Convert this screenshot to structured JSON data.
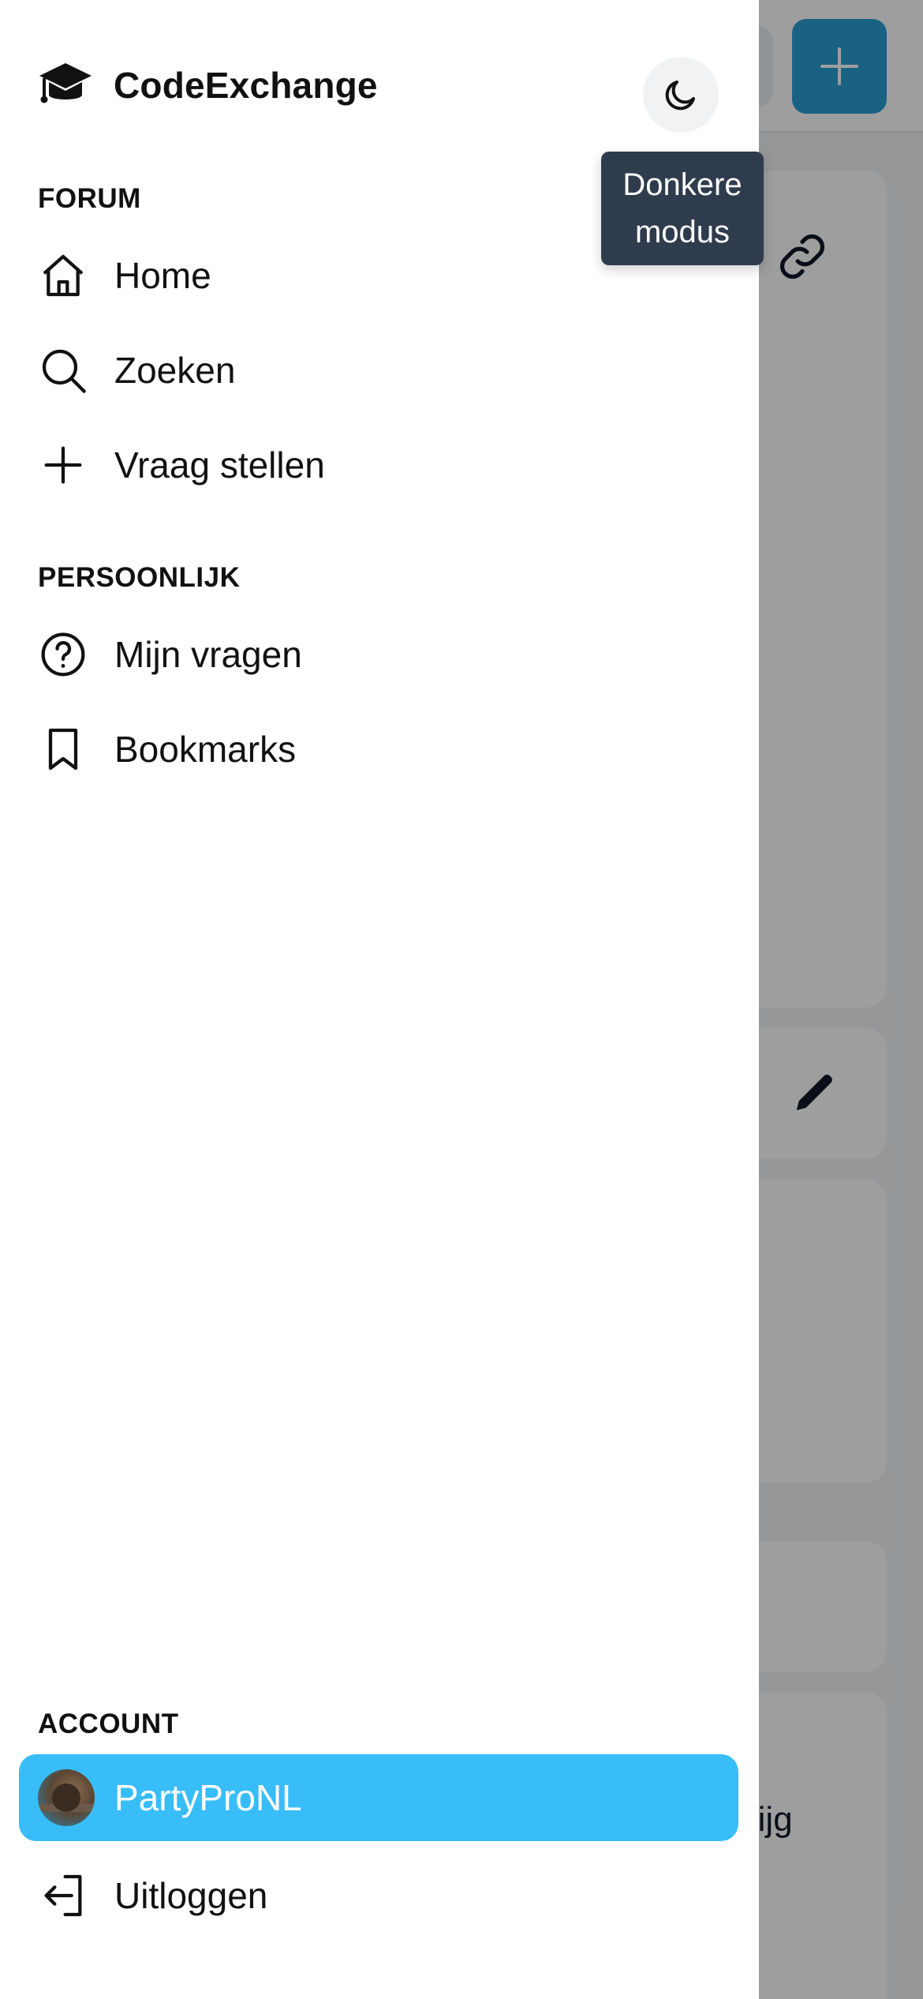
{
  "brand": {
    "name": "CodeExchange",
    "icon": "graduation-cap-icon"
  },
  "theme_toggle": {
    "icon": "moon-icon",
    "tooltip_line1": "Donkere",
    "tooltip_line2": "modus"
  },
  "sections": {
    "forum": {
      "label": "FORUM",
      "items": [
        {
          "label": "Home",
          "icon": "home-icon"
        },
        {
          "label": "Zoeken",
          "icon": "search-icon"
        },
        {
          "label": "Vraag stellen",
          "icon": "plus-icon"
        }
      ]
    },
    "personal": {
      "label": "PERSOONLIJK",
      "items": [
        {
          "label": "Mijn vragen",
          "icon": "question-circle-icon"
        },
        {
          "label": "Bookmarks",
          "icon": "bookmark-icon"
        }
      ]
    },
    "account": {
      "label": "ACCOUNT",
      "user": {
        "name": "PartyProNL",
        "icon": "avatar"
      },
      "logout": {
        "label": "Uitloggen",
        "icon": "logout-icon"
      }
    }
  },
  "background": {
    "partial_text": "rijg"
  },
  "colors": {
    "accent": "#38bdf8",
    "primary_button": "#2a9fd6",
    "tooltip_bg": "#2f3c4d"
  }
}
